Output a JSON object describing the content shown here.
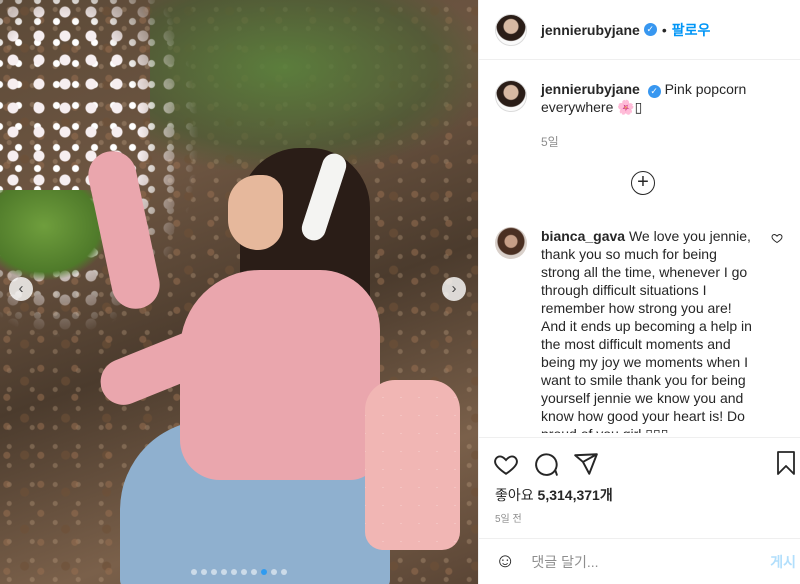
{
  "header": {
    "username": "jennierubyjane",
    "separator": "•",
    "follow_label": "팔로우",
    "verified_glyph": "✓"
  },
  "caption": {
    "username": "jennierubyjane",
    "text": "Pink popcorn everywhere 🌸▯",
    "time": "5일"
  },
  "load_more": "+",
  "comment": {
    "username": "bianca_gava",
    "text": "We love you jennie, thank you so much for being strong all the time, whenever I go through difficult situations I remember how strong you are! And it ends up becoming a help in the most difficult moments and being my joy we moments when I want to smile thank you for being yourself jennie we know you and know how good your heart is! Do proud of you girl ▯▯▯"
  },
  "likes": {
    "label": "좋아요",
    "count": "5,314,371개"
  },
  "posted_time": "5일 전",
  "composer": {
    "emoji_glyph": "☺",
    "placeholder": "댓글 달기...",
    "post_label": "게시"
  },
  "carousel": {
    "prev_glyph": "‹",
    "next_glyph": "›",
    "dot_count": 10,
    "active_index": 7
  },
  "colors": {
    "accent": "#0095f6",
    "verified": "#3897f0",
    "active_dot": "#2f9bf0"
  },
  "icons": [
    "heart-icon",
    "comment-icon",
    "share-icon",
    "bookmark-icon",
    "emoji-icon",
    "plus-circle-icon",
    "verified-icon"
  ]
}
